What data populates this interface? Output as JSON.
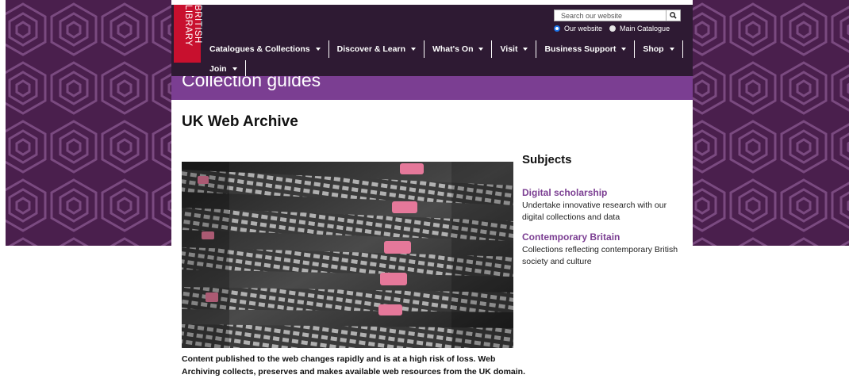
{
  "brand": {
    "logo_line1": "BRITISH",
    "logo_line2": "LIBRARY",
    "color": "#c8102e"
  },
  "search": {
    "placeholder": "Search our website",
    "options": [
      {
        "label": "Our website",
        "checked": true
      },
      {
        "label": "Main Catalogue",
        "checked": false
      }
    ]
  },
  "nav": {
    "items": [
      {
        "label": "Catalogues & Collections"
      },
      {
        "label": "Discover & Learn"
      },
      {
        "label": "What's On"
      },
      {
        "label": "Visit"
      },
      {
        "label": "Business Support"
      },
      {
        "label": "Shop"
      },
      {
        "label": "Join"
      }
    ]
  },
  "band": {
    "title": "Collection guides",
    "color": "#7b3e92"
  },
  "page": {
    "title": "UK Web Archive",
    "caption": "Content published to the web changes rapidly and is at a high risk of loss. Web Archiving collects, preserves and makes available web resources from the UK domain."
  },
  "sidebar": {
    "title": "Subjects",
    "subjects": [
      {
        "title": "Digital scholarship",
        "description": "Undertake innovative research with our digital collections and data"
      },
      {
        "title": "Contemporary Britain",
        "description": "Collections reflecting contemporary British society and culture"
      }
    ]
  },
  "colors": {
    "nav_bg": "#2e1a33",
    "pattern": "#4a1f4d",
    "accent": "#7b3e92"
  }
}
